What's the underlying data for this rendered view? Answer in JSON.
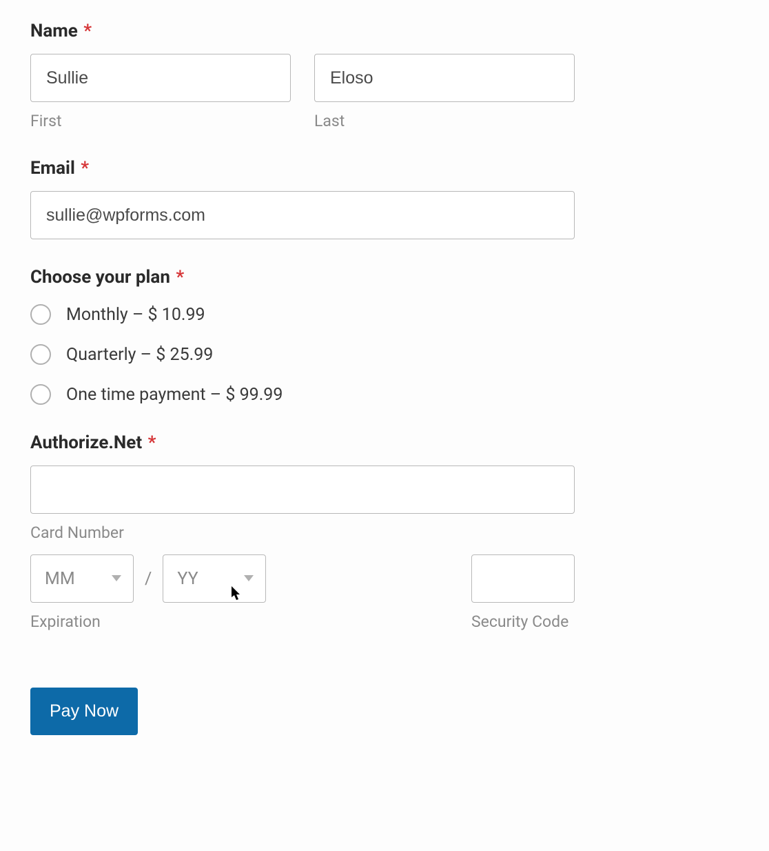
{
  "name": {
    "label": "Name",
    "first_value": "Sullie",
    "first_sublabel": "First",
    "last_value": "Eloso",
    "last_sublabel": "Last"
  },
  "email": {
    "label": "Email",
    "value": "sullie@wpforms.com"
  },
  "plan": {
    "label": "Choose your plan",
    "options": [
      "Monthly – $ 10.99",
      "Quarterly – $ 25.99",
      "One time payment – $ 99.99"
    ]
  },
  "payment": {
    "label": "Authorize.Net",
    "card_sublabel": "Card Number",
    "exp_mm_placeholder": "MM",
    "exp_yy_placeholder": "YY",
    "exp_separator": "/",
    "exp_sublabel": "Expiration",
    "sec_sublabel": "Security Code"
  },
  "submit": {
    "label": "Pay Now"
  },
  "required_mark": "*"
}
